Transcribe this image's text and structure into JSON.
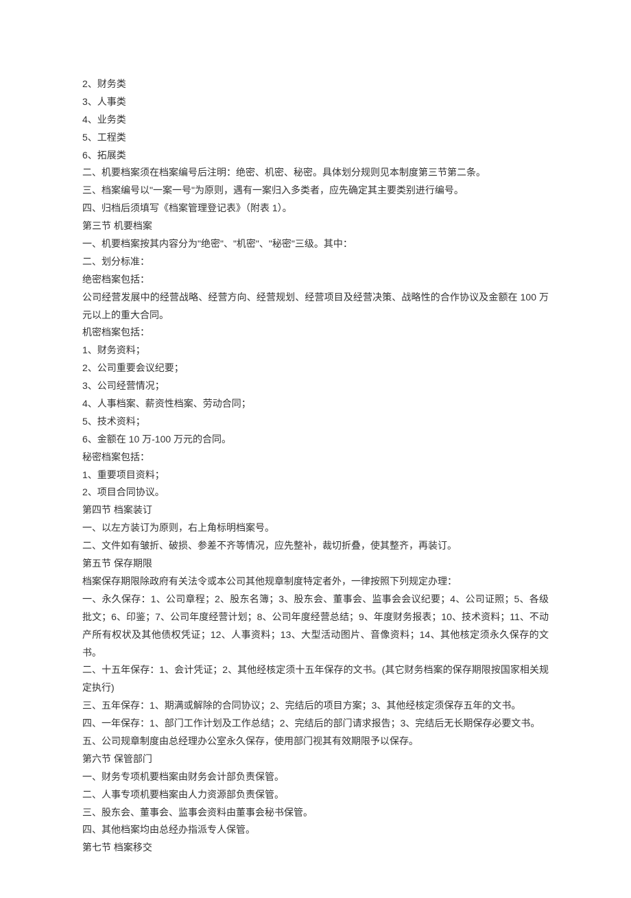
{
  "paragraphs": [
    "2、财务类",
    "3、人事类",
    "4、业务类",
    "5、工程类",
    "6、拓展类",
    "二、机要档案须在档案编号后注明：绝密、机密、秘密。具体划分规则见本制度第三节第二条。",
    "三、档案编号以\"一案一号\"为原则，遇有一案归入多类者，应先确定其主要类别进行编号。",
    "四、归档后须填写《档案管理登记表》（附表 1）。",
    "第三节 机要档案",
    "一、机要档案按其内容分为\"绝密\"、\"机密\"、\"秘密\"三级。其中：",
    "二、划分标准：",
    "绝密档案包括：",
    "公司经营发展中的经营战略、经营方向、经营规划、经营项目及经营决策、战略性的合作协议及金额在 100 万元以上的重大合同。",
    "机密档案包括：",
    "1、财务资料；",
    "2、公司重要会议纪要；",
    "3、公司经营情况；",
    "4、人事档案、薪资性档案、劳动合同；",
    "5、技术资料；",
    "6、金额在 10 万-100 万元的合同。",
    "秘密档案包括：",
    "1、重要项目资料；",
    "2、项目合同协议。",
    "第四节 档案装订",
    "一、以左方装订为原则，右上角标明档案号。",
    "二、文件如有皱折、破损、参差不齐等情况，应先整补，裁切折叠，使其整齐，再装订。",
    "第五节 保存期限",
    "档案保存期限除政府有关法令或本公司其他规章制度特定者外，一律按照下列规定办理：",
    "一、永久保存：1、公司章程；2、股东名簿；3、股东会、董事会、监事会会议纪要；4、公司证照；5、各级批文；6、印鉴；7、公司年度经营计划；8、公司年度经营总结；9、年度财务报表；10、技术资料；11、不动产所有权状及其他债权凭证；12、人事资料；13、大型活动图片、音像资料；14、其他核定须永久保存的文书。",
    "二、十五年保存：1、会计凭证；2、其他经核定须十五年保存的文书。(其它财务档案的保存期限按国家相关规定执行)",
    "三、五年保存：1、期满或解除的合同协议；2、完结后的项目方案；3、其他经核定须保存五年的文书。",
    "四、一年保存：1、部门工作计划及工作总结；2、完结后的部门请求报告；3、完结后无长期保存必要文书。",
    "五、公司规章制度由总经理办公室永久保存，使用部门视其有效期限予以保存。",
    "第六节 保管部门",
    "一、财务专项机要档案由财务会计部负责保管。",
    "二、人事专项机要档案由人力资源部负责保管。",
    "三、股东会、董事会、监事会资料由董事会秘书保管。",
    "四、其他档案均由总经办指派专人保管。",
    "第七节 档案移交"
  ]
}
